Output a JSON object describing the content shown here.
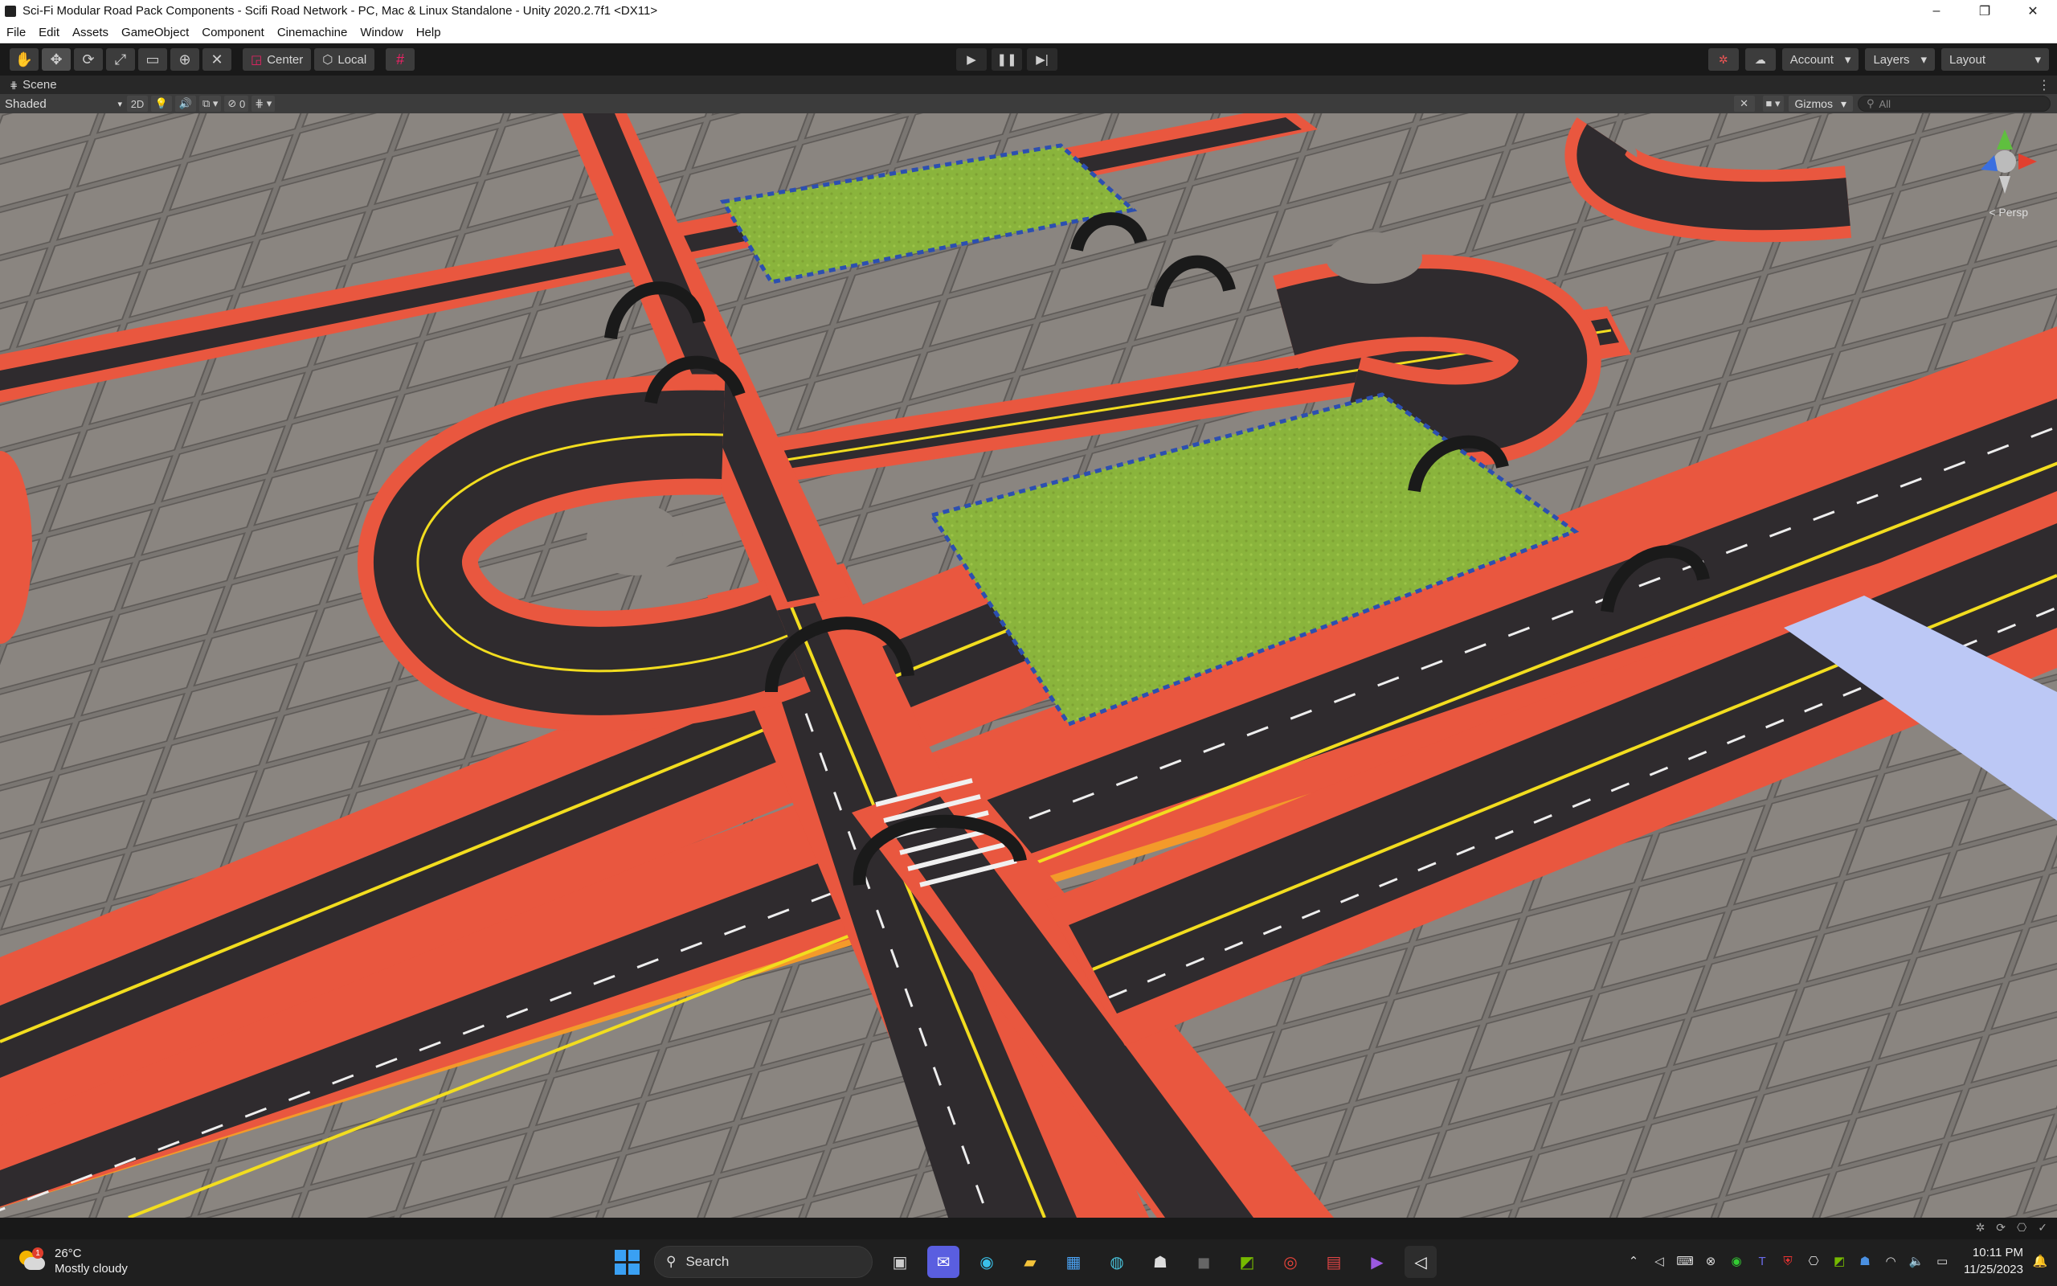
{
  "window": {
    "title": "Sci-Fi Modular Road Pack Components - Scifi Road Network - PC, Mac & Linux Standalone - Unity 2020.2.7f1 <DX11>",
    "minimize": "–",
    "maximize": "❐",
    "close": "✕"
  },
  "menu": [
    "File",
    "Edit",
    "Assets",
    "GameObject",
    "Component",
    "Cinemachine",
    "Window",
    "Help"
  ],
  "toolbar": {
    "tools": [
      "hand-icon",
      "move-icon",
      "rotate-icon",
      "scale-icon",
      "rect-tool-icon",
      "transform-icon",
      "custom-tool-icon"
    ],
    "pivot_center": "Center",
    "pivot_local": "Local",
    "account": "Account",
    "layers": "Layers",
    "layout": "Layout"
  },
  "scene_tab": {
    "label": "Scene"
  },
  "scene_bar": {
    "shading": "Shaded",
    "mode_2d": "2D",
    "hidden_count": "0",
    "gizmos": "Gizmos",
    "search_placeholder": "All",
    "persp": "< Persp"
  },
  "taskbar": {
    "weather_temp": "26°C",
    "weather_desc": "Mostly cloudy",
    "weather_badge": "1",
    "search": "Search",
    "time": "10:11 PM",
    "date": "11/25/2023"
  },
  "colors": {
    "road": "#2f2b2e",
    "curb": "#e9573f",
    "curb_edge": "#f39a2a",
    "grass": "#8ab43c",
    "ground": "#7a7672",
    "lane_yellow": "#f2dd1f"
  }
}
